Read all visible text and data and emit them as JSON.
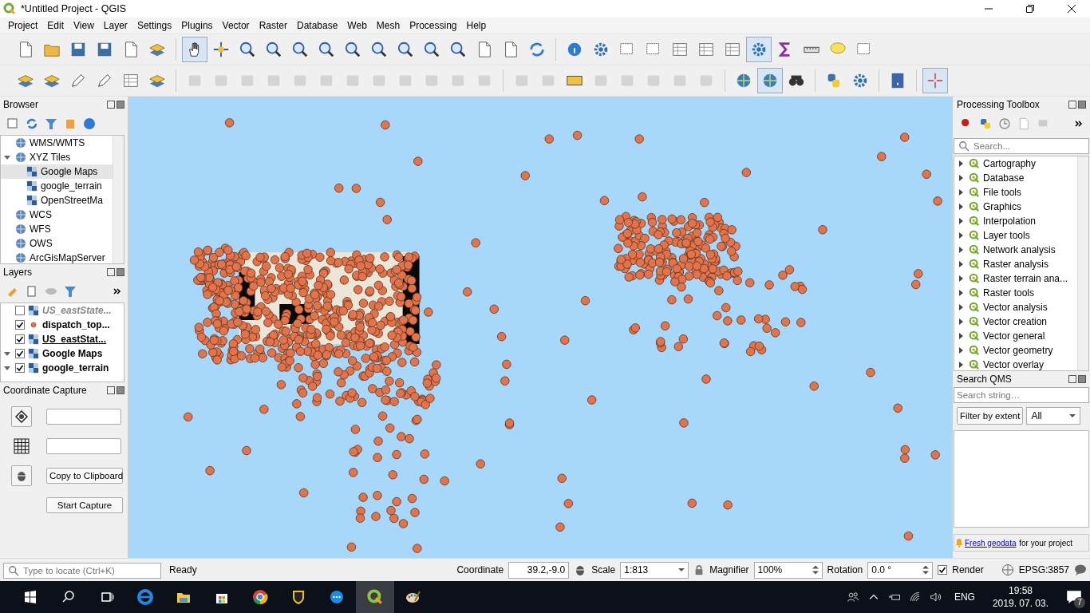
{
  "window": {
    "title": "*Untitled Project - QGIS"
  },
  "menu": [
    "Project",
    "Edit",
    "View",
    "Layer",
    "Settings",
    "Plugins",
    "Vector",
    "Raster",
    "Database",
    "Web",
    "Mesh",
    "Processing",
    "Help"
  ],
  "browser": {
    "title": "Browser",
    "items": [
      {
        "label": "WMS/WMTS",
        "selected": false,
        "expanded": false
      },
      {
        "label": "XYZ Tiles",
        "selected": false,
        "expanded": true,
        "children": [
          {
            "label": "Google Maps",
            "selected": true
          },
          {
            "label": "google_terrain",
            "selected": false
          },
          {
            "label": "OpenStreetMa",
            "selected": false
          }
        ]
      },
      {
        "label": "WCS",
        "selected": false,
        "expanded": false
      },
      {
        "label": "WFS",
        "selected": false,
        "expanded": false
      },
      {
        "label": "OWS",
        "selected": false,
        "expanded": false
      },
      {
        "label": "ArcGisMapServer",
        "selected": false,
        "expanded": false
      }
    ]
  },
  "layers": {
    "title": "Layers",
    "items": [
      {
        "label": "US_eastState...",
        "kind": "raster",
        "checked": false,
        "current": false,
        "expander": false
      },
      {
        "label": "dispatch_top...",
        "kind": "point",
        "checked": true,
        "current": false,
        "expander": false
      },
      {
        "label": "US_eastStat...",
        "kind": "raster",
        "checked": true,
        "current": true,
        "expander": false
      },
      {
        "label": "Google Maps",
        "kind": "raster",
        "checked": true,
        "current": false,
        "expander": true
      },
      {
        "label": "google_terrain",
        "kind": "raster",
        "checked": true,
        "current": false,
        "expander": true
      }
    ]
  },
  "coordinate_capture": {
    "title": "Coordinate Capture",
    "copy_button": "Copy to Clipboard",
    "start_button": "Start Capture"
  },
  "processing": {
    "title": "Processing Toolbox",
    "search_placeholder": "Search...",
    "items": [
      "Cartography",
      "Database",
      "File tools",
      "Graphics",
      "Interpolation",
      "Layer tools",
      "Network analysis",
      "Raster analysis",
      "Raster terrain ana...",
      "Raster tools",
      "Vector analysis",
      "Vector creation",
      "Vector general",
      "Vector geometry",
      "Vector overlay"
    ]
  },
  "search_qms": {
    "title": "Search QMS",
    "placeholder": "Search string…",
    "filter_button": "Filter by extent",
    "filter_value": "All",
    "link": "Fresh geodata",
    "link_rest": " for your project"
  },
  "status_bar": {
    "locate_placeholder": "Type to locate (Ctrl+K)",
    "message": "Ready",
    "coordinate_label": "Coordinate",
    "coordinate": "39.2,-9.0",
    "scale_label": "Scale",
    "scale": "1:813",
    "magnifier_label": "Magnifier",
    "magnifier": "100%",
    "rotation_label": "Rotation",
    "rotation": "0.0 °",
    "render_label": "Render",
    "render": true,
    "crs": "EPSG:3857"
  },
  "taskbar": {
    "language": "ENG",
    "time": "19:58",
    "date": "2019. 07. 03.",
    "notifications": "7"
  }
}
